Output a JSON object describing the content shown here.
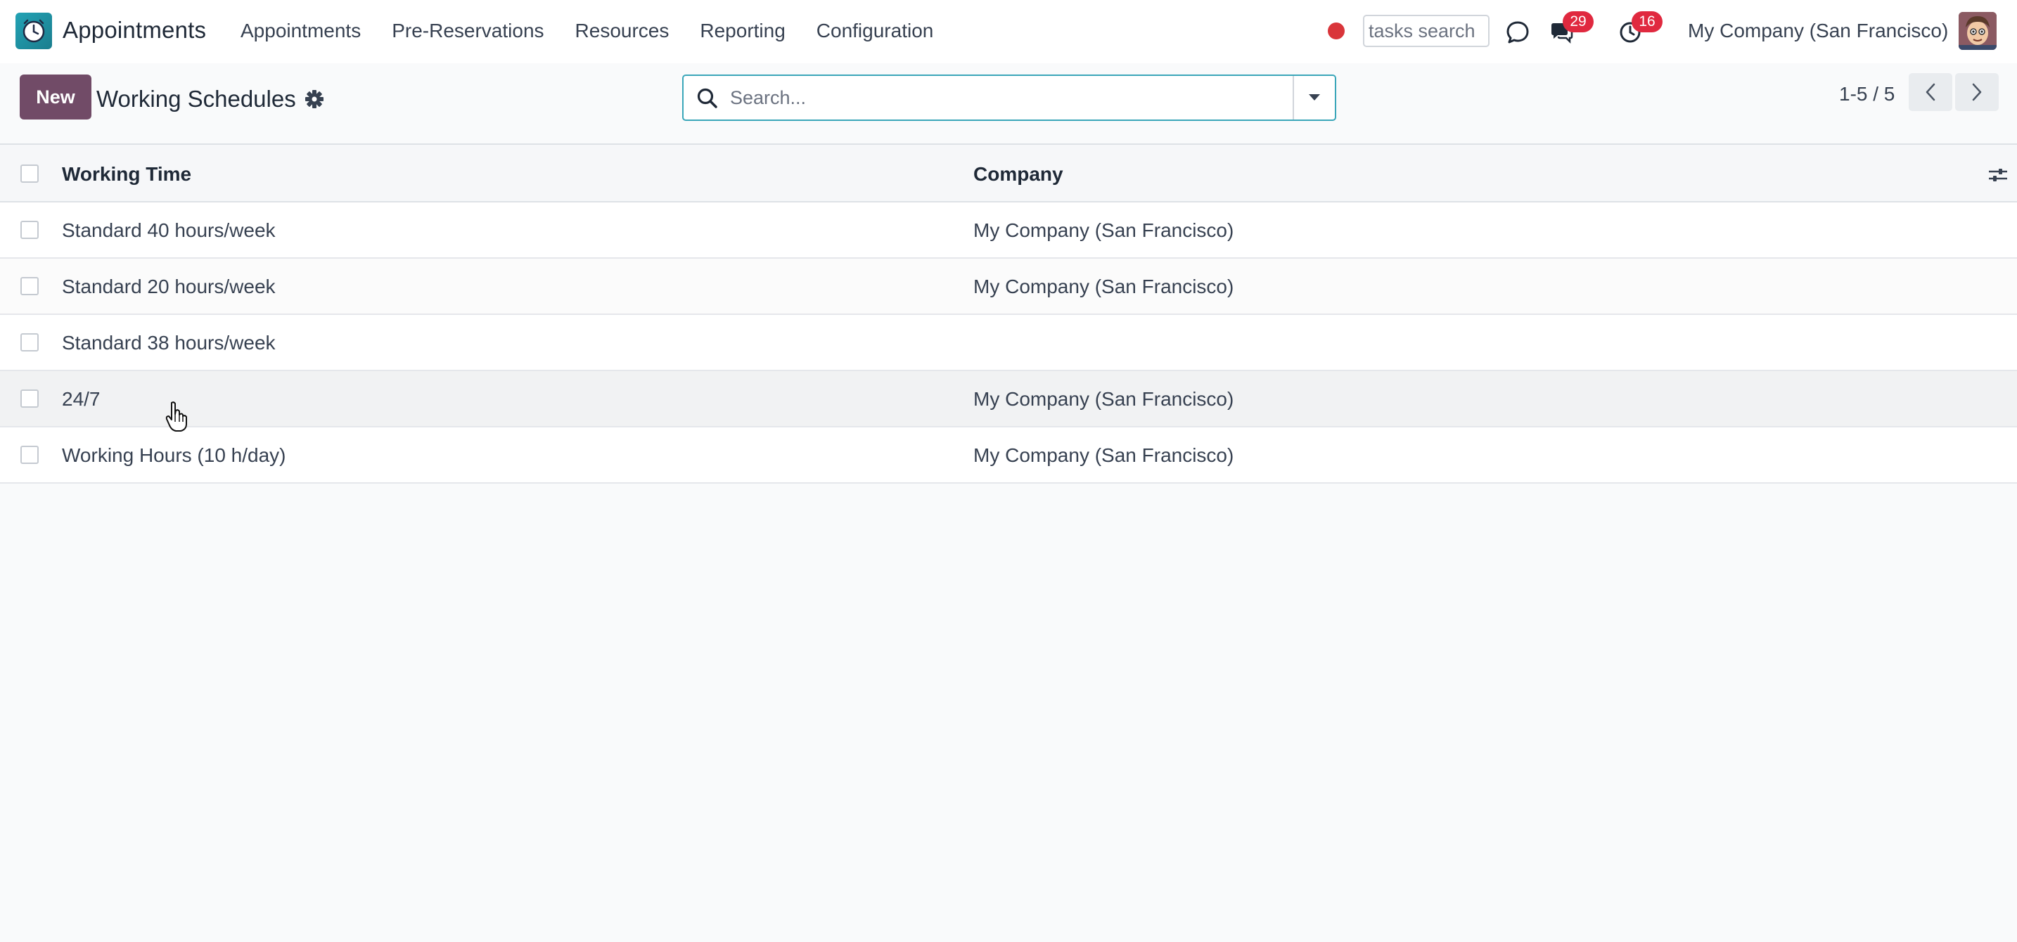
{
  "navbar": {
    "app_name": "Appointments",
    "app_logo_icon": "clock-icon",
    "menu": [
      {
        "label": "Appointments"
      },
      {
        "label": "Pre-Reservations"
      },
      {
        "label": "Resources"
      },
      {
        "label": "Reporting"
      },
      {
        "label": "Configuration"
      }
    ],
    "tasks_search_placeholder": "tasks search",
    "messages_badge": "29",
    "activities_badge": "16",
    "company": "My Company (San Francisco)"
  },
  "control_panel": {
    "new_label": "New",
    "title": "Working Schedules",
    "search_placeholder": "Search...",
    "pager": "1-5 / 5"
  },
  "list": {
    "columns": [
      "Working Time",
      "Company"
    ],
    "rows": [
      {
        "name": "Standard 40 hours/week",
        "company": "My Company (San Francisco)"
      },
      {
        "name": "Standard 20 hours/week",
        "company": "My Company (San Francisco)"
      },
      {
        "name": "Standard 38 hours/week",
        "company": ""
      },
      {
        "name": "24/7",
        "company": "My Company (San Francisco)"
      },
      {
        "name": "Working Hours (10 h/day)",
        "company": "My Company (San Francisco)"
      }
    ]
  },
  "colors": {
    "brand": "#714b67",
    "accent": "#3aa6b9",
    "badge": "#e0293f",
    "record": "#d9353a"
  }
}
